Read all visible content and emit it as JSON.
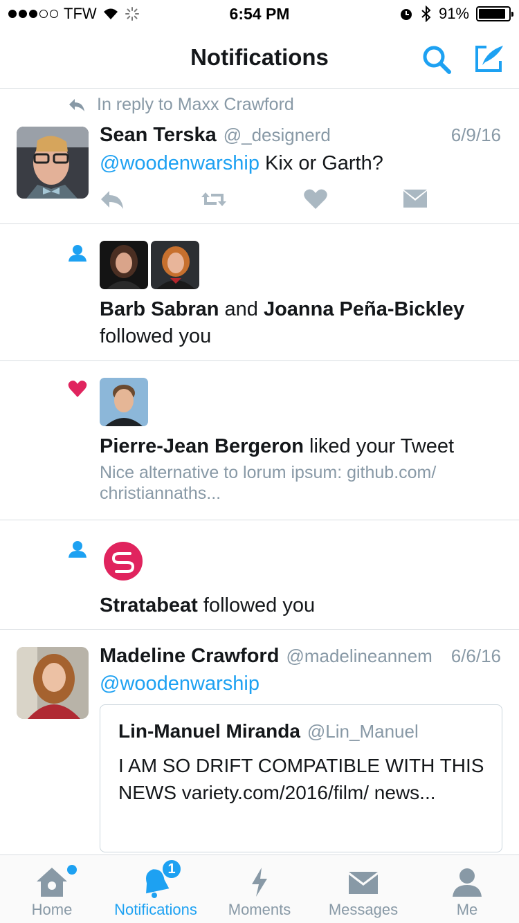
{
  "status_bar": {
    "carrier": "TFW",
    "time": "6:54 PM",
    "battery": "91%",
    "battery_level": 0.91
  },
  "nav": {
    "title": "Notifications",
    "icons": [
      "search-icon",
      "compose-icon"
    ]
  },
  "feed": {
    "tweet1": {
      "reply_context": "In reply to Maxx Crawford",
      "name": "Sean Terska",
      "handle": "@_designerd",
      "date": "6/9/16",
      "mention": "@woodenwarship",
      "text": " Kix or Garth?"
    },
    "follow1": {
      "name_a": "Barb Sabran",
      "connector": " and ",
      "name_b": "Joanna Peña-Bickley",
      "action": "followed you"
    },
    "like1": {
      "name": "Pierre-Jean Bergeron",
      "action": " liked your Tweet",
      "snippet": "Nice alternative to lorum ipsum: github.com/ christiannaths..."
    },
    "follow2": {
      "name": "Stratabeat",
      "action": " followed you"
    },
    "tweet2": {
      "name": "Madeline Crawford",
      "handle": "@madelineannem",
      "date": "6/6/16",
      "mention": "@woodenwarship",
      "quote": {
        "name": "Lin-Manuel Miranda",
        "handle": "@Lin_Manuel",
        "text": "I AM SO DRIFT COMPATIBLE WITH THIS NEWS variety.com/2016/film/ news..."
      }
    }
  },
  "tabs": {
    "home": "Home",
    "notifications": "Notifications",
    "notifications_badge": "1",
    "moments": "Moments",
    "messages": "Messages",
    "me": "Me"
  },
  "colors": {
    "accent": "#1da1f2",
    "like": "#e0245e",
    "muted": "#8899a6",
    "text": "#14171a"
  }
}
